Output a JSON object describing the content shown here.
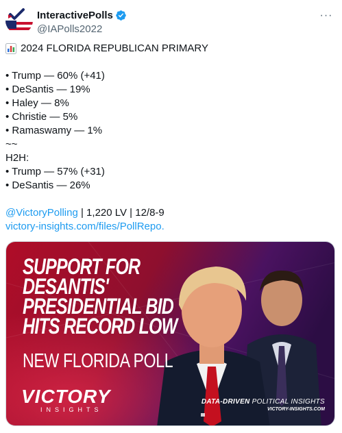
{
  "tweet": {
    "author_name": "InteractivePolls",
    "author_handle": "@IAPolls2022",
    "more_label": "···",
    "lines": [
      "2024 FLORIDA REPUBLICAN PRIMARY",
      "• Trump — 60% (+41)",
      "• DeSantis — 19%",
      "• Haley — 8%",
      "• Christie — 5%",
      "• Ramaswamy — 1%",
      "~~",
      "H2H:",
      "• Trump — 57% (+31)",
      "• DeSantis — 26%"
    ],
    "source_mention": "@VictoryPolling",
    "source_details": " | 1,220 LV | 12/8-9",
    "link_text": "victory-insights.com/files/PollRepo."
  },
  "media": {
    "headline_lines": [
      "SUPPORT FOR",
      "DESANTIS'",
      "PRESIDENTIAL BID",
      "HITS RECORD LOW"
    ],
    "subhead": "NEW FLORIDA POLL",
    "brand_name": "VICTORY",
    "brand_sub": "INSIGHTS",
    "tagline_bold": "DATA-DRIVEN",
    "tagline_rest": " POLITICAL INSIGHTS",
    "tagline_url": "VICTORY-INSIGHTS.COM"
  },
  "icons": {
    "verified": "verified-badge-icon",
    "chart": "bar-chart-emoji-icon",
    "avatar": "flag-checkmark-avatar"
  },
  "colors": {
    "verified": "#1d9bf0",
    "link": "#1d9bf0",
    "handle": "#536471",
    "media_red": "#c8102e",
    "media_purple": "#3a1150"
  }
}
